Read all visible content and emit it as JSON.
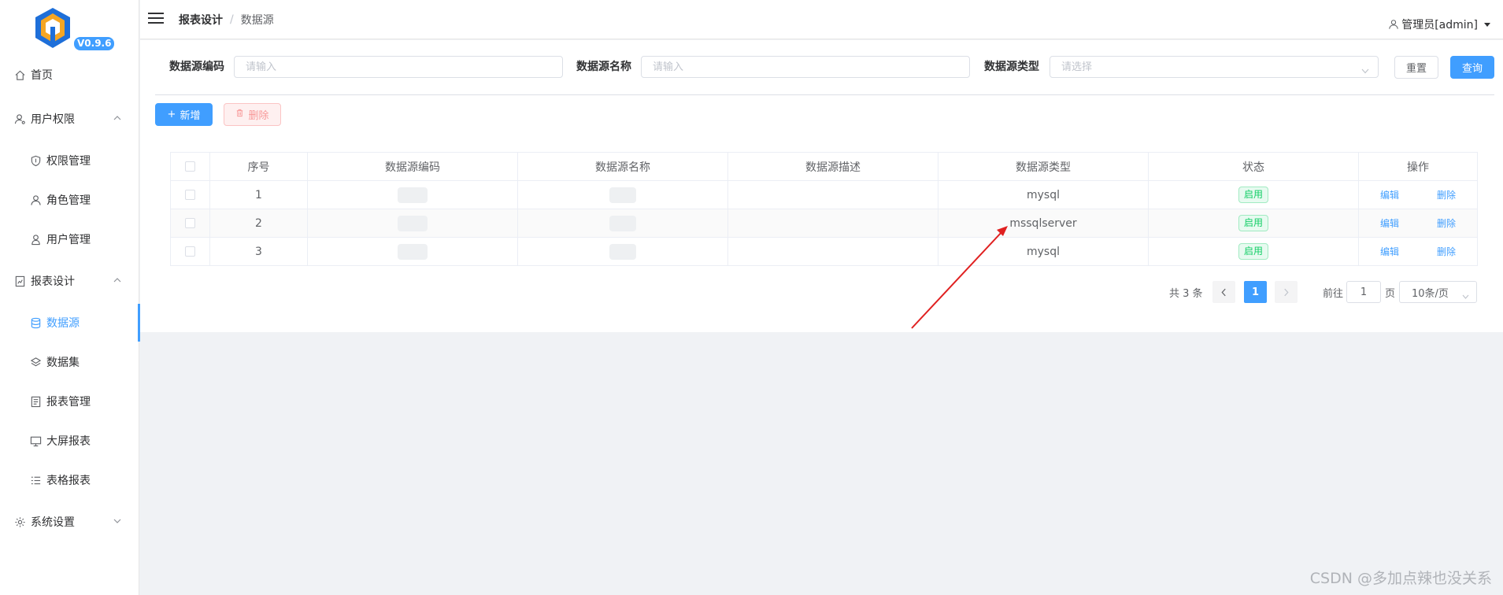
{
  "app": {
    "version": "V0.9.6",
    "brand_color": "#409eff"
  },
  "sidebar": {
    "items": [
      {
        "label": "首页",
        "icon": "home-icon",
        "level": "top"
      },
      {
        "label": "用户权限",
        "icon": "user-key-icon",
        "level": "top",
        "expanded": true
      },
      {
        "label": "权限管理",
        "icon": "shield-icon",
        "level": "sub"
      },
      {
        "label": "角色管理",
        "icon": "user-icon",
        "level": "sub"
      },
      {
        "label": "用户管理",
        "icon": "person-icon",
        "level": "sub"
      },
      {
        "label": "报表设计",
        "icon": "report-icon",
        "level": "top",
        "expanded": true
      },
      {
        "label": "数据源",
        "icon": "database-icon",
        "level": "sub",
        "active": true
      },
      {
        "label": "数据集",
        "icon": "dataset-icon",
        "level": "sub"
      },
      {
        "label": "报表管理",
        "icon": "report-manage-icon",
        "level": "sub"
      },
      {
        "label": "大屏报表",
        "icon": "monitor-icon",
        "level": "sub"
      },
      {
        "label": "表格报表",
        "icon": "list-icon",
        "level": "sub"
      },
      {
        "label": "系统设置",
        "icon": "gear-icon",
        "level": "top",
        "expanded": false
      }
    ]
  },
  "header": {
    "breadcrumb": [
      "报表设计",
      "数据源"
    ],
    "separator": "/",
    "user": "管理员[admin]"
  },
  "filters": {
    "code_label": "数据源编码",
    "code_placeholder": "请输入",
    "name_label": "数据源名称",
    "name_placeholder": "请输入",
    "type_label": "数据源类型",
    "type_placeholder": "请选择",
    "reset_label": "重置",
    "search_label": "查询"
  },
  "toolbar": {
    "add_label": "新增",
    "delete_label": "删除"
  },
  "table": {
    "columns": [
      "序号",
      "数据源编码",
      "数据源名称",
      "数据源描述",
      "数据源类型",
      "状态",
      "操作"
    ],
    "rows": [
      {
        "index": "1",
        "type": "mysql",
        "status": "启用",
        "edit": "编辑",
        "delete": "删除"
      },
      {
        "index": "2",
        "type": "mssqlserver",
        "status": "启用",
        "edit": "编辑",
        "delete": "删除"
      },
      {
        "index": "3",
        "type": "mysql",
        "status": "启用",
        "edit": "编辑",
        "delete": "删除"
      }
    ]
  },
  "pagination": {
    "total": "共 3 条",
    "current": "1",
    "goto_label": "前往",
    "goto_value": "1",
    "page_suffix": "页",
    "page_size": "10条/页"
  },
  "annotation": {
    "arrow_color": "#e02020"
  },
  "watermark": "CSDN @多加点辣也没关系"
}
